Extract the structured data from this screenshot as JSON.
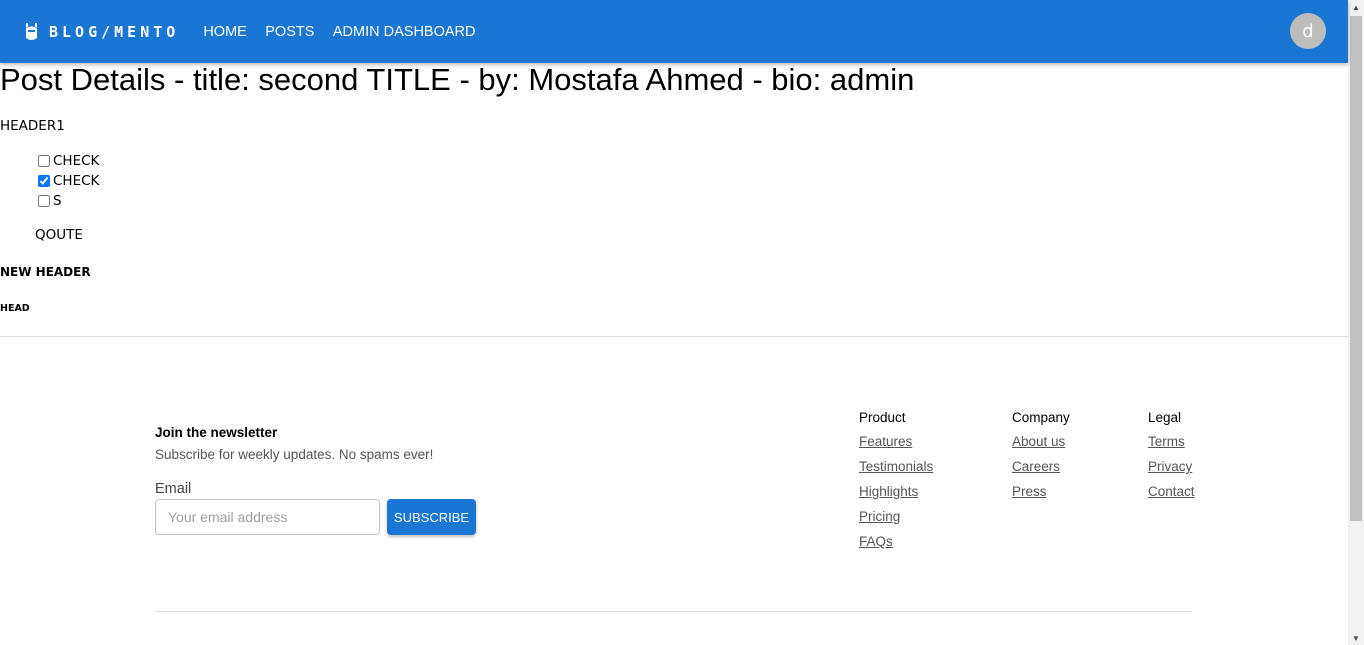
{
  "header": {
    "logo_text": "BLOG/MENTO",
    "logo_icon": "robot-icon",
    "nav": [
      "HOME",
      "POSTS",
      "ADMIN DASHBOARD"
    ],
    "avatar_letter": "d",
    "bg_color": "#1976d2"
  },
  "post": {
    "title": "Post Details - title: second TITLE - by: Mostafa Ahmed - bio: admin",
    "header1": "HEADER1",
    "checklist": [
      {
        "label": "CHECK",
        "checked": false
      },
      {
        "label": "CHECK",
        "checked": true
      },
      {
        "label": "S",
        "checked": false
      }
    ],
    "quote": "QOUTE",
    "new_header": "NEW HEADER",
    "head": "HEAD"
  },
  "footer": {
    "newsletter": {
      "title": "Join the newsletter",
      "subtitle": "Subscribe for weekly updates. No spams ever!",
      "email_label": "Email",
      "email_placeholder": "Your email address",
      "button": "SUBSCRIBE"
    },
    "columns": {
      "product": {
        "title": "Product",
        "links": [
          "Features",
          "Testimonials",
          "Highlights",
          "Pricing",
          "FAQs"
        ]
      },
      "company": {
        "title": "Company",
        "links": [
          "About us",
          "Careers",
          "Press"
        ]
      },
      "legal": {
        "title": "Legal",
        "links": [
          "Terms",
          "Privacy",
          "Contact"
        ]
      }
    }
  }
}
